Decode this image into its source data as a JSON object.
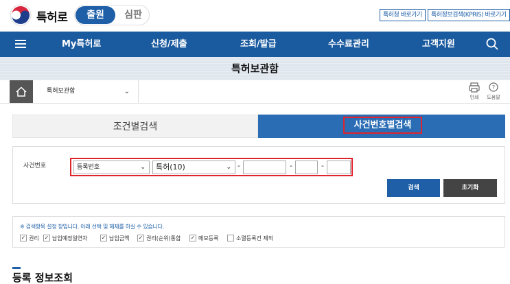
{
  "header": {
    "site_name": "특허로",
    "segment_active": "출원",
    "segment_inactive": "심판",
    "links": [
      "특허청 바로가기",
      "특허정보검색(KPRIS) 바로가기"
    ]
  },
  "nav": {
    "items": [
      "My특허로",
      "신청/제출",
      "조회/발급",
      "수수료관리",
      "고객지원"
    ]
  },
  "banner": {
    "title": "특허보관함"
  },
  "breadcrumb": {
    "current": "특허보관함",
    "tools": [
      "인쇄",
      "도움말"
    ]
  },
  "tabs": {
    "left": "조건별검색",
    "right": "사건번호별검색"
  },
  "search": {
    "field_label": "사건번호",
    "type_select": "등록번호",
    "kind_select": "특허(10)",
    "dash": "-",
    "search_button": "검색",
    "reset_button": "초기화"
  },
  "options": {
    "note": "※ 검색항목 설정 창입니다. 아래 선택 및 해제를 하실 수 있습니다.",
    "items": [
      {
        "label": "권리",
        "checked": true
      },
      {
        "label": "납입예정일연차",
        "checked": true
      },
      {
        "label": "납입금액",
        "checked": true
      },
      {
        "label": "권리(순위)통합",
        "checked": true
      },
      {
        "label": "메모등록",
        "checked": true
      },
      {
        "label": "소멸등록건 제외",
        "checked": false
      }
    ],
    "check_mark": "✓"
  },
  "section": {
    "title": "등록 정보조회"
  },
  "colors": {
    "primary": "#1a5a9f",
    "tab_active": "#2a6db5",
    "highlight": "#e0242b",
    "reset_button": "#444444"
  }
}
